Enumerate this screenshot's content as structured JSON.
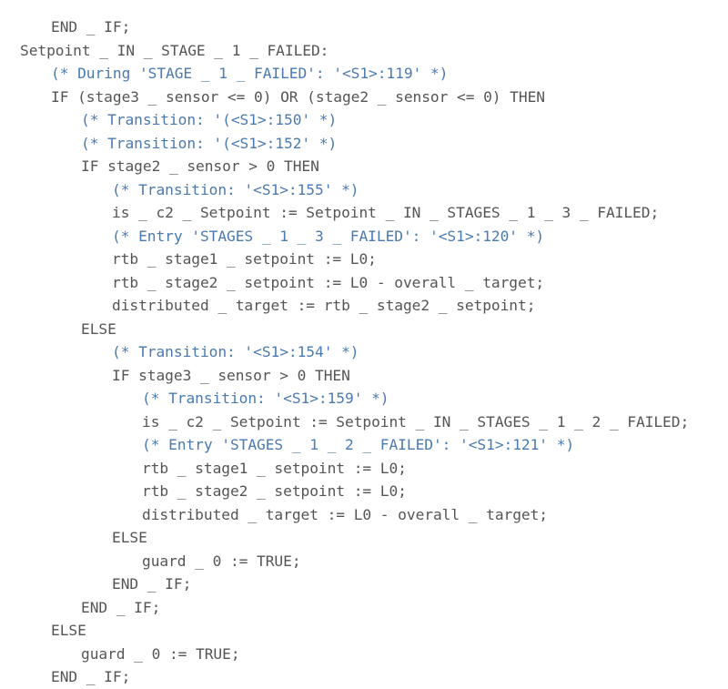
{
  "document": {
    "kind": "structured-text-code-listing",
    "language": "IEC 61131-3 Structured Text",
    "background_color": "#ffffff",
    "code_color": "#555555",
    "comment_color": "#4a7ab0"
  },
  "lines": [
    {
      "indent": 1,
      "kind": "code",
      "text": "END _ IF;"
    },
    {
      "indent": 0,
      "kind": "code",
      "text": "Setpoint _ IN _ STAGE _ 1 _ FAILED:"
    },
    {
      "indent": 1,
      "kind": "comment",
      "text": "(* During 'STAGE _ 1 _ FAILED': '<S1>:119' *)"
    },
    {
      "indent": 1,
      "kind": "code",
      "text": "IF (stage3 _ sensor <= 0) OR (stage2 _ sensor <= 0) THEN"
    },
    {
      "indent": 2,
      "kind": "comment",
      "text": "(* Transition: '(<S1>:150' *)"
    },
    {
      "indent": 2,
      "kind": "comment",
      "text": "(* Transition: '(<S1>:152' *)"
    },
    {
      "indent": 2,
      "kind": "code",
      "text": "IF stage2 _ sensor > 0 THEN"
    },
    {
      "indent": 3,
      "kind": "comment",
      "text": "(* Transition: '<S1>:155' *)"
    },
    {
      "indent": 3,
      "kind": "code",
      "text": "is _ c2 _ Setpoint := Setpoint _ IN _ STAGES _ 1 _ 3 _ FAILED;"
    },
    {
      "indent": 3,
      "kind": "comment",
      "text": "(* Entry 'STAGES _ 1 _ 3 _ FAILED': '<S1>:120' *)"
    },
    {
      "indent": 3,
      "kind": "code",
      "text": "rtb _ stage1 _ setpoint := L0;"
    },
    {
      "indent": 3,
      "kind": "code",
      "text": "rtb _ stage2 _ setpoint := L0 - overall _ target;"
    },
    {
      "indent": 3,
      "kind": "code",
      "text": "distributed _ target := rtb _ stage2 _ setpoint;"
    },
    {
      "indent": 2,
      "kind": "code",
      "text": "ELSE"
    },
    {
      "indent": 3,
      "kind": "comment",
      "text": "(* Transition: '<S1>:154' *)"
    },
    {
      "indent": 3,
      "kind": "code",
      "text": "IF stage3 _ sensor > 0 THEN"
    },
    {
      "indent": 4,
      "kind": "comment",
      "text": "(* Transition: '<S1>:159' *)"
    },
    {
      "indent": 4,
      "kind": "code",
      "text": "is _ c2 _ Setpoint := Setpoint _ IN _ STAGES _ 1 _ 2 _ FAILED;"
    },
    {
      "indent": 4,
      "kind": "comment",
      "text": "(* Entry 'STAGES _ 1 _ 2 _ FAILED': '<S1>:121' *)"
    },
    {
      "indent": 4,
      "kind": "code",
      "text": "rtb _ stage1 _ setpoint := L0;"
    },
    {
      "indent": 4,
      "kind": "code",
      "text": "rtb _ stage2 _ setpoint := L0;"
    },
    {
      "indent": 4,
      "kind": "code",
      "text": "distributed _ target := L0 - overall _ target;"
    },
    {
      "indent": 3,
      "kind": "code",
      "text": "ELSE"
    },
    {
      "indent": 4,
      "kind": "code",
      "text": "guard _ 0 := TRUE;"
    },
    {
      "indent": 3,
      "kind": "code",
      "text": "END _ IF;"
    },
    {
      "indent": 2,
      "kind": "code",
      "text": "END _ IF;"
    },
    {
      "indent": 1,
      "kind": "code",
      "text": "ELSE"
    },
    {
      "indent": 2,
      "kind": "code",
      "text": "guard _ 0 := TRUE;"
    },
    {
      "indent": 1,
      "kind": "code",
      "text": "END _ IF;"
    }
  ]
}
